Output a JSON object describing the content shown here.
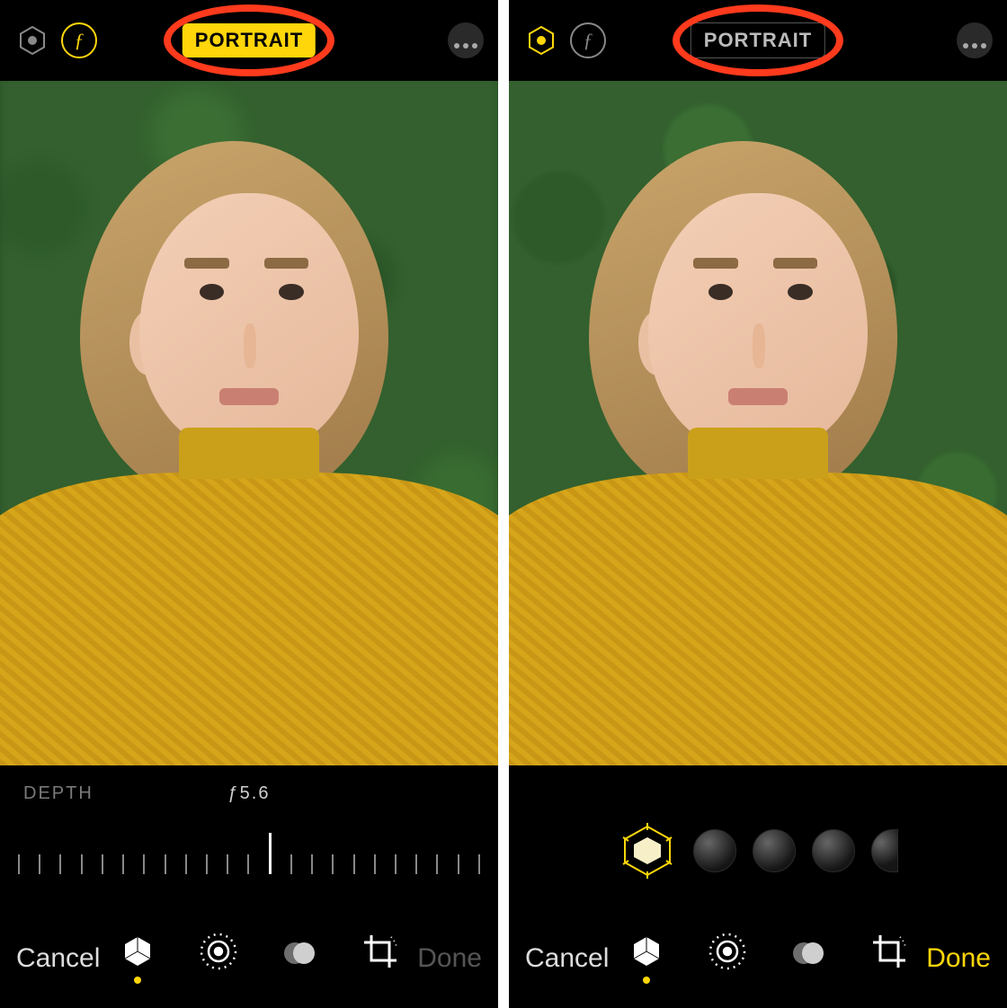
{
  "left": {
    "mode_label": "PORTRAIT",
    "mode_active": true,
    "live_icon_active": false,
    "f_icon_active": true,
    "depth_label": "DEPTH",
    "depth_value": "ƒ5.6",
    "cancel_label": "Cancel",
    "done_label": "Done",
    "done_enabled": false,
    "active_tool_index": 0,
    "ruler_tick_count": 23,
    "ruler_active_index": 12
  },
  "right": {
    "mode_label": "PORTRAIT",
    "mode_active": false,
    "live_icon_active": true,
    "f_icon_active": false,
    "cancel_label": "Cancel",
    "done_label": "Done",
    "done_enabled": true,
    "active_tool_index": 0,
    "lighting_options_count": 4,
    "lighting_selected_index": 0
  },
  "icons": {
    "live": "live-photo-icon",
    "aperture": "aperture-f-icon",
    "more": "more-icon",
    "cube_tool": "portrait-tool-icon",
    "adjust_tool": "adjust-tool-icon",
    "filters_tool": "filters-tool-icon",
    "crop_tool": "crop-tool-icon",
    "lighting_cube": "lighting-cube-icon"
  },
  "colors": {
    "accent": "#ffd60a",
    "annotation": "#ff3a1d"
  }
}
